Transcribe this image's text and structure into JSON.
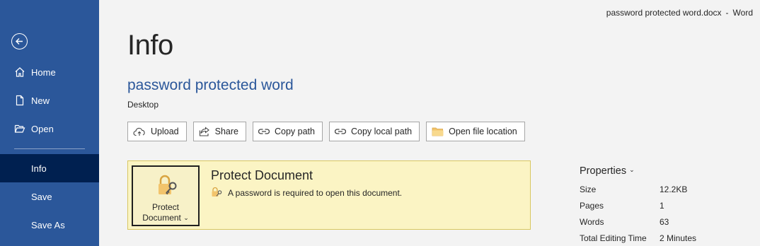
{
  "window": {
    "filename": "password protected word.docx",
    "separator": "-",
    "app": "Word"
  },
  "sidebar": {
    "back_icon": "arrow-left-circle-icon",
    "items": [
      {
        "label": "Home",
        "icon": "home-icon"
      },
      {
        "label": "New",
        "icon": "new-document-icon"
      },
      {
        "label": "Open",
        "icon": "folder-open-icon"
      },
      {
        "label": "Info",
        "active": true
      },
      {
        "label": "Save"
      },
      {
        "label": "Save As"
      }
    ]
  },
  "page": {
    "title": "Info",
    "doc_name": "password protected word",
    "doc_location": "Desktop"
  },
  "actions": [
    {
      "label": "Upload",
      "icon": "cloud-upload-icon"
    },
    {
      "label": "Share",
      "icon": "share-icon"
    },
    {
      "label": "Copy path",
      "icon": "link-icon"
    },
    {
      "label": "Copy local path",
      "icon": "link-icon"
    },
    {
      "label": "Open file location",
      "icon": "folder-icon"
    }
  ],
  "protect": {
    "button_line1": "Protect",
    "button_line2": "Document",
    "button_icon": "lock-key-icon",
    "heading": "Protect Document",
    "description": "A password is required to open this document.",
    "description_icon": "lock-key-icon"
  },
  "properties": {
    "title": "Properties",
    "rows": [
      {
        "key": "Size",
        "value": "12.2KB"
      },
      {
        "key": "Pages",
        "value": "1"
      },
      {
        "key": "Words",
        "value": "63"
      },
      {
        "key": "Total Editing Time",
        "value": "2 Minutes"
      }
    ]
  },
  "colors": {
    "sidebar": "#2b579a",
    "sidebar_active": "#002050",
    "accent_text": "#2b579a",
    "protect_panel": "#fbf4c4",
    "protect_border": "#d8c760"
  }
}
